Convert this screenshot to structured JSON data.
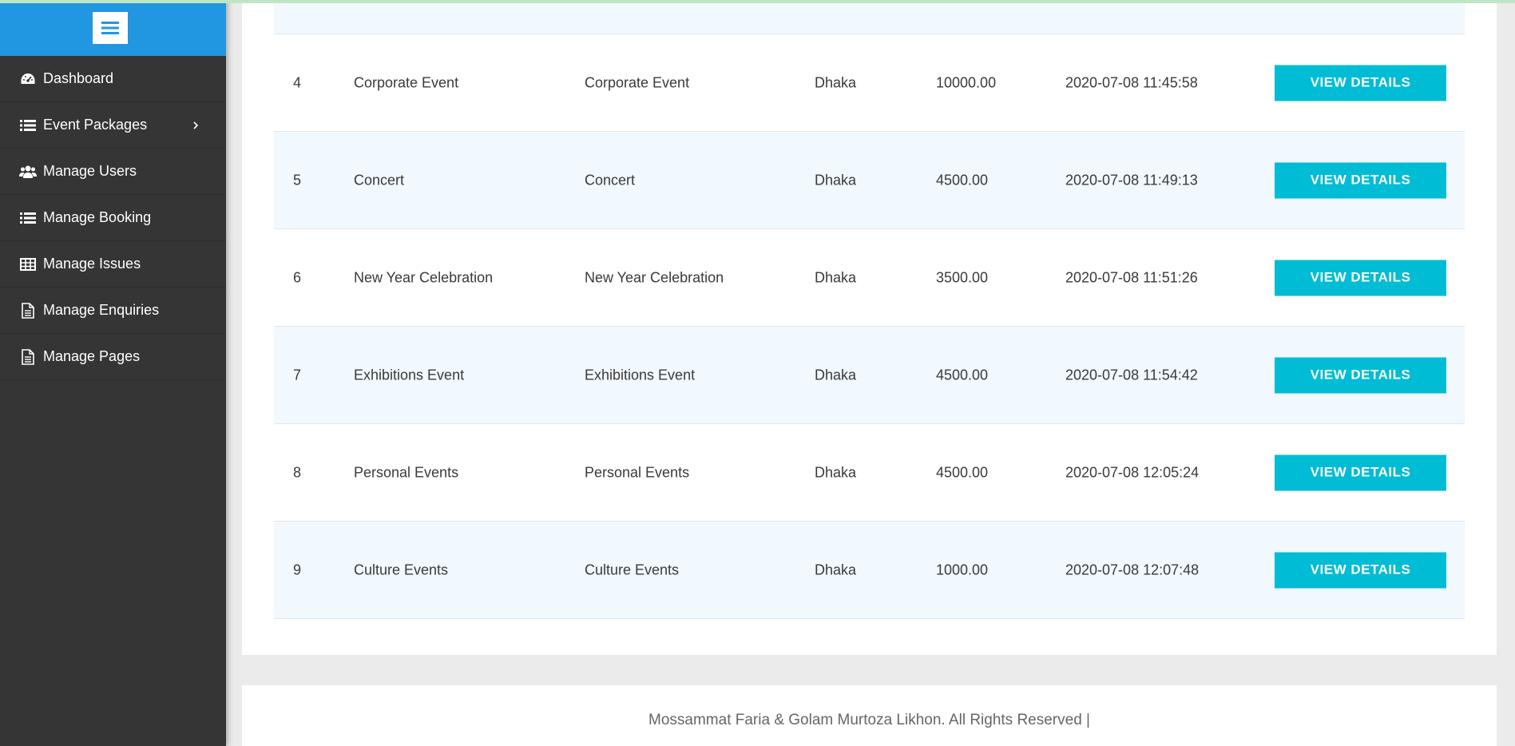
{
  "sidebar": {
    "menu_toggle_icon": "hamburger-icon",
    "items": [
      {
        "label": "Dashboard",
        "icon": "dashboard-icon"
      },
      {
        "label": "Event Packages",
        "icon": "list-icon",
        "has_submenu": true
      },
      {
        "label": "Manage Users",
        "icon": "users-icon"
      },
      {
        "label": "Manage Booking",
        "icon": "list-icon"
      },
      {
        "label": "Manage Issues",
        "icon": "table-icon"
      },
      {
        "label": "Manage Enquiries",
        "icon": "document-icon"
      },
      {
        "label": "Manage Pages",
        "icon": "document-icon"
      }
    ]
  },
  "table": {
    "rows": [
      {
        "id": "4",
        "name": "Corporate Event",
        "description": "Corporate Event",
        "location": "Dhaka",
        "price": "10000.00",
        "created": "2020-07-08 11:45:58",
        "action": "VIEW DETAILS"
      },
      {
        "id": "5",
        "name": "Concert",
        "description": "Concert",
        "location": "Dhaka",
        "price": "4500.00",
        "created": "2020-07-08 11:49:13",
        "action": "VIEW DETAILS"
      },
      {
        "id": "6",
        "name": "New Year Celebration",
        "description": "New Year Celebration",
        "location": "Dhaka",
        "price": "3500.00",
        "created": "2020-07-08 11:51:26",
        "action": "VIEW DETAILS"
      },
      {
        "id": "7",
        "name": "Exhibitions Event",
        "description": "Exhibitions Event",
        "location": "Dhaka",
        "price": "4500.00",
        "created": "2020-07-08 11:54:42",
        "action": "VIEW DETAILS"
      },
      {
        "id": "8",
        "name": "Personal Events",
        "description": "Personal Events",
        "location": "Dhaka",
        "price": "4500.00",
        "created": "2020-07-08 12:05:24",
        "action": "VIEW DETAILS"
      },
      {
        "id": "9",
        "name": "Culture Events",
        "description": "Culture Events",
        "location": "Dhaka",
        "price": "1000.00",
        "created": "2020-07-08 12:07:48",
        "action": "VIEW DETAILS"
      }
    ]
  },
  "footer": {
    "text": "Mossammat Faria & Golam Murtoza Likhon. All Rights Reserved |"
  },
  "colors": {
    "sidebar_bg": "#353535",
    "sidebar_header": "#2196e1",
    "button_bg": "#00bcd4",
    "row_stripe": "#f1f8fe"
  }
}
